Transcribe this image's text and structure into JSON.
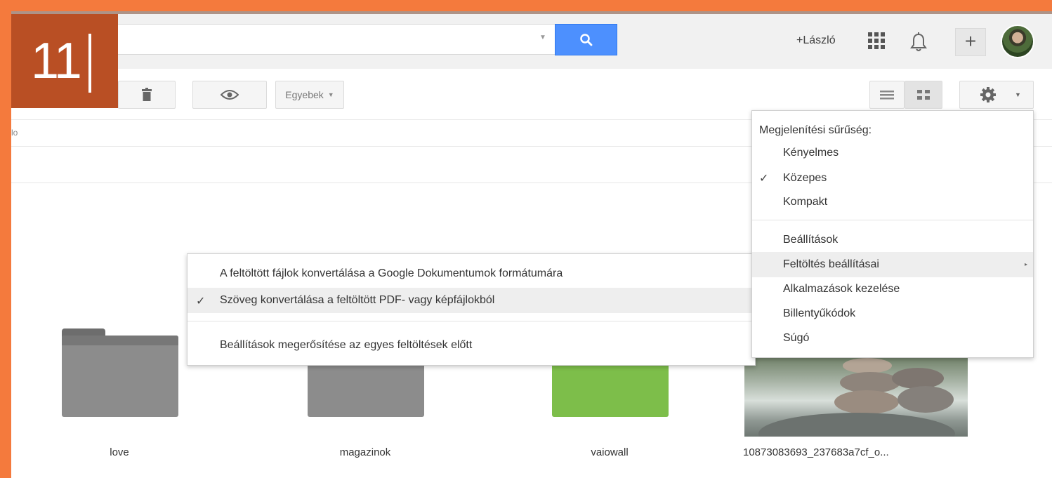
{
  "step_number": "11",
  "header": {
    "user_link": "+László"
  },
  "toolbar": {
    "more_label": "Egyebek"
  },
  "breadcrumb_fragment": "lo",
  "items": [
    {
      "name": "love",
      "kind": "folder-gray"
    },
    {
      "name": "magazinok",
      "kind": "folder-gray"
    },
    {
      "name": "vaiowall",
      "kind": "folder-green"
    },
    {
      "name": "10873083693_237683a7cf_o...",
      "kind": "image"
    }
  ],
  "upload_submenu": {
    "items": [
      {
        "label": "A feltöltött fájlok konvertálása a Google Dokumentumok formátumára",
        "checked": false,
        "highlighted": false
      },
      {
        "label": "Szöveg konvertálása a feltöltött PDF- vagy képfájlokból",
        "checked": true,
        "highlighted": true
      },
      {
        "label": "Beállítások megerősítése az egyes feltöltések előtt",
        "checked": false,
        "highlighted": false
      }
    ]
  },
  "settings_menu": {
    "density_heading": "Megjelenítési sűrűség:",
    "density_options": [
      {
        "label": "Kényelmes",
        "checked": false
      },
      {
        "label": "Közepes",
        "checked": true
      },
      {
        "label": "Kompakt",
        "checked": false
      }
    ],
    "items": [
      {
        "label": "Beállítások",
        "highlighted": false
      },
      {
        "label": "Feltöltés beállításai",
        "highlighted": true,
        "has_submenu": true
      },
      {
        "label": "Alkalmazások kezelése",
        "highlighted": false
      },
      {
        "label": "Billentyűkódok",
        "highlighted": false
      },
      {
        "label": "Súgó",
        "highlighted": false
      }
    ]
  },
  "colors": {
    "frame": "#f47a3d",
    "badge": "#b94f24",
    "search_button": "#4d90fe",
    "green_folder": "#7dbe4a"
  },
  "check_mark": "✓",
  "submenu_arrow": "▸"
}
